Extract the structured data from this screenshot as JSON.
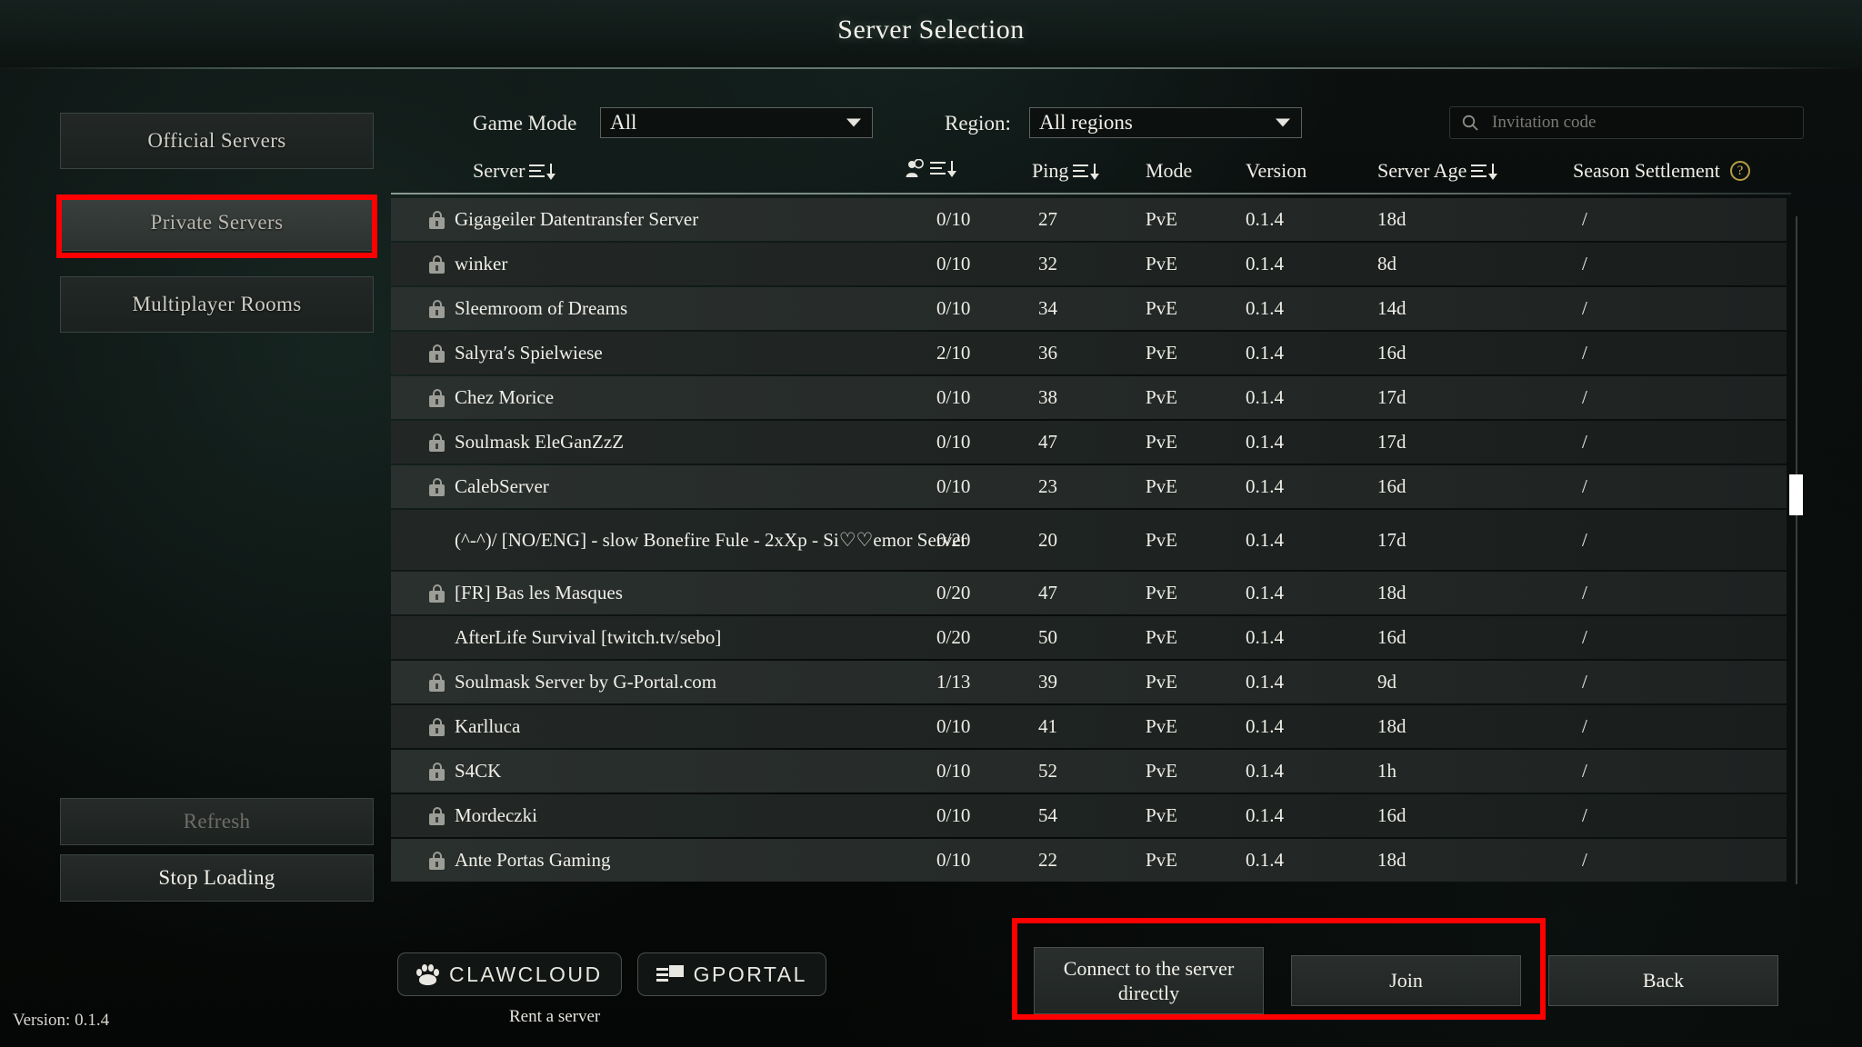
{
  "window": {
    "title": "Server Selection",
    "version_label": "Version: 0.1.4"
  },
  "sidebar": {
    "items": [
      {
        "label": "Official Servers",
        "selected": false
      },
      {
        "label": "Private Servers",
        "selected": true
      },
      {
        "label": "Multiplayer Rooms",
        "selected": false
      }
    ],
    "refresh_label": "Refresh",
    "stop_loading_label": "Stop Loading"
  },
  "filters": {
    "game_mode_label": "Game Mode",
    "game_mode_value": "All",
    "region_label": "Region:",
    "region_value": "All regions"
  },
  "search": {
    "placeholder": "Invitation code",
    "icon": "search-icon",
    "value": ""
  },
  "table": {
    "columns": {
      "server": "Server",
      "players_icon": "players-icon",
      "ping": "Ping",
      "mode": "Mode",
      "version": "Version",
      "server_age": "Server Age",
      "season_settlement": "Season Settlement",
      "help_badge": "?"
    },
    "rows": [
      {
        "locked": true,
        "name": "Gigageiler Datentransfer Server",
        "players": "0/10",
        "ping": "27",
        "mode": "PvE",
        "version": "0.1.4",
        "age": "18d",
        "season": "/"
      },
      {
        "locked": true,
        "name": "winker",
        "players": "0/10",
        "ping": "32",
        "mode": "PvE",
        "version": "0.1.4",
        "age": "8d",
        "season": "/"
      },
      {
        "locked": true,
        "name": "Sleemroom of Dreams",
        "players": "0/10",
        "ping": "34",
        "mode": "PvE",
        "version": "0.1.4",
        "age": "14d",
        "season": "/"
      },
      {
        "locked": true,
        "name": "Salyraʹs Spielwiese",
        "players": "2/10",
        "ping": "36",
        "mode": "PvE",
        "version": "0.1.4",
        "age": "16d",
        "season": "/"
      },
      {
        "locked": true,
        "name": "Chez Morice",
        "players": "0/10",
        "ping": "38",
        "mode": "PvE",
        "version": "0.1.4",
        "age": "17d",
        "season": "/"
      },
      {
        "locked": true,
        "name": "Soulmask EleGanZzZ",
        "players": "0/10",
        "ping": "47",
        "mode": "PvE",
        "version": "0.1.4",
        "age": "17d",
        "season": "/"
      },
      {
        "locked": true,
        "name": "CalebServer",
        "players": "0/10",
        "ping": "23",
        "mode": "PvE",
        "version": "0.1.4",
        "age": "16d",
        "season": "/"
      },
      {
        "locked": false,
        "name": "(^-^)/ [NO/ENG] - slow Bonefire Fule - 2xXp - Si♡♡emor Server",
        "players": "0/20",
        "ping": "20",
        "mode": "PvE",
        "version": "0.1.4",
        "age": "17d",
        "season": "/",
        "tall": true
      },
      {
        "locked": true,
        "name": "[FR] Bas les Masques",
        "players": "0/20",
        "ping": "47",
        "mode": "PvE",
        "version": "0.1.4",
        "age": "18d",
        "season": "/"
      },
      {
        "locked": false,
        "name": "AfterLife Survival [twitch.tv/sebo]",
        "players": "0/20",
        "ping": "50",
        "mode": "PvE",
        "version": "0.1.4",
        "age": "16d",
        "season": "/"
      },
      {
        "locked": true,
        "name": "Soulmask Server by G-Portal.com",
        "players": "1/13",
        "ping": "39",
        "mode": "PvE",
        "version": "0.1.4",
        "age": "9d",
        "season": "/"
      },
      {
        "locked": true,
        "name": "Karlluca",
        "players": "0/10",
        "ping": "41",
        "mode": "PvE",
        "version": "0.1.4",
        "age": "18d",
        "season": "/"
      },
      {
        "locked": true,
        "name": "S4CK",
        "players": "0/10",
        "ping": "52",
        "mode": "PvE",
        "version": "0.1.4",
        "age": "1h",
        "season": "/"
      },
      {
        "locked": true,
        "name": "Mordeczki",
        "players": "0/10",
        "ping": "54",
        "mode": "PvE",
        "version": "0.1.4",
        "age": "16d",
        "season": "/"
      },
      {
        "locked": true,
        "name": "Ante Portas Gaming",
        "players": "0/10",
        "ping": "22",
        "mode": "PvE",
        "version": "0.1.4",
        "age": "18d",
        "season": "/"
      }
    ]
  },
  "sponsors": {
    "claw_cloud": "CLAWCLOUD",
    "gportal": "GPORTAL",
    "rent_a_server": "Rent a server"
  },
  "actions": {
    "connect_directly": "Connect to the server directly",
    "join": "Join",
    "back": "Back"
  },
  "annotations": {
    "color": "#ff0000"
  }
}
